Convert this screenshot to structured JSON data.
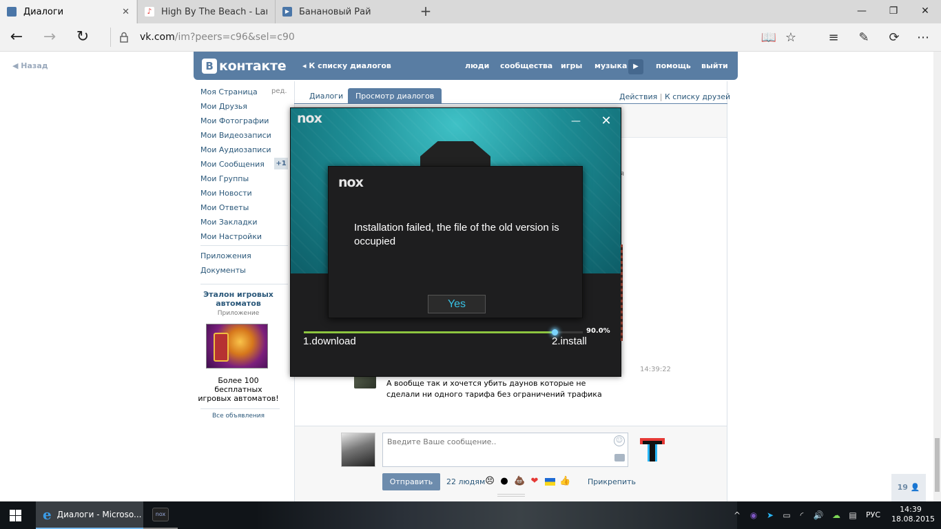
{
  "browser": {
    "tabs": [
      {
        "title": "Диалоги",
        "icon": "vk-chat-icon",
        "icon_color": "#4a76a8",
        "active": true,
        "close": "✕"
      },
      {
        "title": "High By The Beach - Lana Del Rey",
        "icon": "music-note-icon",
        "icon_color": "#e53935",
        "active": false
      },
      {
        "title": "Банановый Рай",
        "icon": "video-play-icon",
        "icon_color": "#4a76a8",
        "active": false
      }
    ],
    "new_tab": "+",
    "address": {
      "host": "vk.com",
      "path": "/im?peers=c96&sel=c90"
    },
    "window_controls": {
      "minimize": "—",
      "maximize": "❐",
      "close": "✕"
    }
  },
  "vk": {
    "back_link": "Назад",
    "brand_letter": "В",
    "brand_name": "контакте",
    "header": {
      "back_to_list": "К списку диалогов",
      "links": [
        "люди",
        "сообщества",
        "игры",
        "музыка",
        "помощь",
        "выйти"
      ]
    },
    "left_menu": {
      "items": [
        "Моя Страница",
        "Мои Друзья",
        "Мои Фотографии",
        "Мои Видеозаписи",
        "Мои Аудиозаписи",
        "Мои Сообщения",
        "Мои Группы",
        "Мои Новости",
        "Мои Ответы",
        "Мои Закладки",
        "Мои Настройки"
      ],
      "edit": "ред.",
      "messages_badge": "+1",
      "extra": [
        "Приложения",
        "Документы"
      ]
    },
    "ad": {
      "title": "Эталон игровых автоматов",
      "subtitle": "Приложение",
      "text": "Более 100 бесплатных игровых автоматов!",
      "all": "Все объявления"
    },
    "tabs": {
      "dialogs": "Диалоги",
      "view": "Просмотр диалогов"
    },
    "tab_links": {
      "actions": "Действия",
      "separator": "|",
      "friends": "К списку друзей"
    },
    "peek_text": "я",
    "message": {
      "time": "14:39:22",
      "text": "А вообще так и хочется убить даунов которые не сделали ни одного тарифа без ограничений трафика"
    },
    "composer": {
      "placeholder": "Введите Ваше сообщение..",
      "send": "Отправить",
      "people": "22 людям",
      "attach": "Прикрепить"
    },
    "online_count": "19"
  },
  "nox": {
    "logo": "nox",
    "minimize": "—",
    "close": "✕",
    "dialog": {
      "logo": "nox",
      "message": "Installation failed, the file of the old version is occupied",
      "button": "Yes"
    },
    "progress": {
      "value": 0.9,
      "label": "90.0%",
      "accent": "#8dc63f"
    },
    "steps": {
      "download": "1.download",
      "install": "2.install"
    }
  },
  "taskbar": {
    "edge_label": "Диалоги - Microso...",
    "nox_icon": "nox",
    "language": "РУС",
    "time": "14:39",
    "date": "18.08.2015"
  }
}
